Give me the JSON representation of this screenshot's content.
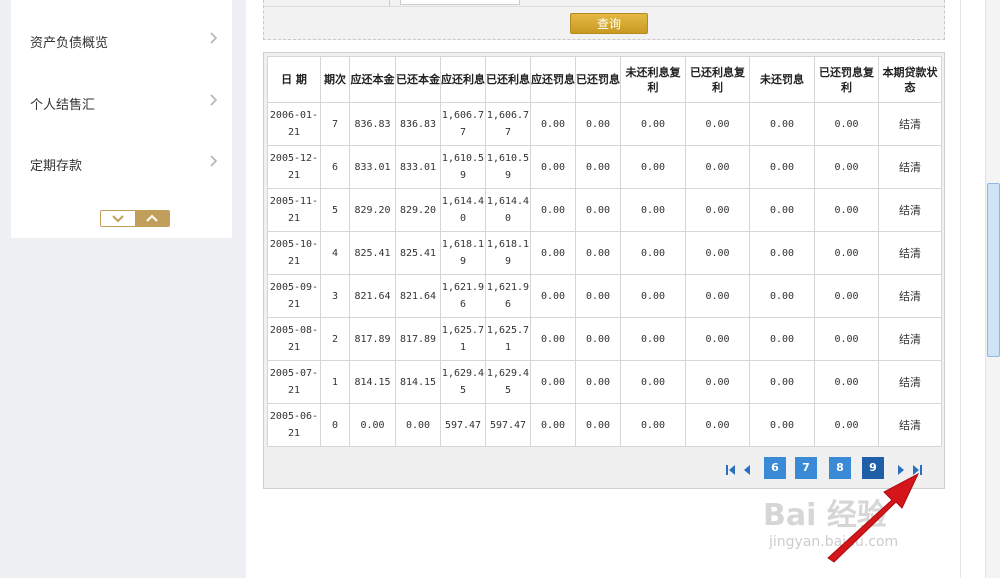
{
  "sidebar": {
    "items": [
      {
        "label": "资产负债概览"
      },
      {
        "label": "个人结售汇"
      },
      {
        "label": "定期存款"
      }
    ]
  },
  "query": {
    "button_label": "查询"
  },
  "table": {
    "headers": [
      "日 期",
      "期次",
      "应还本金",
      "已还本金",
      "应还利息",
      "已还利息",
      "应还罚息",
      "已还罚息",
      "未还利息复利",
      "已还利息复利",
      "未还罚息",
      "已还罚息复利",
      "本期贷款状态"
    ],
    "rows": [
      [
        "2006-01-21",
        "7",
        "836.83",
        "836.83",
        "1,606.77",
        "1,606.77",
        "0.00",
        "0.00",
        "0.00",
        "0.00",
        "0.00",
        "0.00",
        "结清"
      ],
      [
        "2005-12-21",
        "6",
        "833.01",
        "833.01",
        "1,610.59",
        "1,610.59",
        "0.00",
        "0.00",
        "0.00",
        "0.00",
        "0.00",
        "0.00",
        "结清"
      ],
      [
        "2005-11-21",
        "5",
        "829.20",
        "829.20",
        "1,614.40",
        "1,614.40",
        "0.00",
        "0.00",
        "0.00",
        "0.00",
        "0.00",
        "0.00",
        "结清"
      ],
      [
        "2005-10-21",
        "4",
        "825.41",
        "825.41",
        "1,618.19",
        "1,618.19",
        "0.00",
        "0.00",
        "0.00",
        "0.00",
        "0.00",
        "0.00",
        "结清"
      ],
      [
        "2005-09-21",
        "3",
        "821.64",
        "821.64",
        "1,621.96",
        "1,621.96",
        "0.00",
        "0.00",
        "0.00",
        "0.00",
        "0.00",
        "0.00",
        "结清"
      ],
      [
        "2005-08-21",
        "2",
        "817.89",
        "817.89",
        "1,625.71",
        "1,625.71",
        "0.00",
        "0.00",
        "0.00",
        "0.00",
        "0.00",
        "0.00",
        "结清"
      ],
      [
        "2005-07-21",
        "1",
        "814.15",
        "814.15",
        "1,629.45",
        "1,629.45",
        "0.00",
        "0.00",
        "0.00",
        "0.00",
        "0.00",
        "0.00",
        "结清"
      ],
      [
        "2005-06-21",
        "0",
        "0.00",
        "0.00",
        "597.47",
        "597.47",
        "0.00",
        "0.00",
        "0.00",
        "0.00",
        "0.00",
        "0.00",
        "结清"
      ]
    ]
  },
  "pagination": {
    "pages": [
      "6",
      "7",
      "8",
      "9"
    ],
    "current": "9",
    "accent": "#3b8ad6",
    "current_color": "#1f5fa8"
  },
  "watermark": {
    "main": "Bai 经验",
    "sub": "jingyan.baidu.com"
  },
  "colors": {
    "gold": "#c19f5a",
    "annotation_arrow": "#d4161b"
  }
}
